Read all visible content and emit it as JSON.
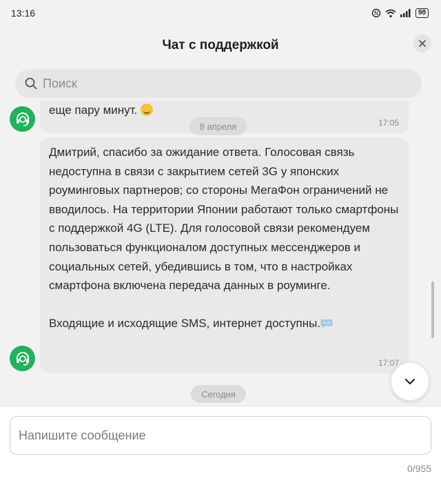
{
  "status_bar": {
    "time": "13:16",
    "battery": "98",
    "icons": [
      "nfc-icon",
      "wifi-icon",
      "signal-icon",
      "battery-icon"
    ]
  },
  "header": {
    "title": "Чат с поддержкой",
    "close_icon": "close-icon"
  },
  "search": {
    "placeholder": "Поиск"
  },
  "chat": {
    "messages": [
      {
        "text": "еще пару минут.",
        "time": "17:05"
      },
      {
        "paragraphs": [
          "Дмитрий, спасибо за ожидание ответа. Голосовая связь недоступна в связи с закрытием сетей 3G у японских роуминговых партнеров; со стороны МегаФон ограничений не вводилось. На территории Японии работают только смартфоны с поддержкой 4G (LTE). Для голосовой связи рекомендуем пользоваться функционалом доступных мессенджеров и социальных сетей, убедившись в том, что в настройках смартфона включена передача данных в роуминге.",
          "Входящие и исходящие SMS, интернет доступны."
        ],
        "time": "17:07"
      }
    ],
    "date_separators": [
      "8 апреля",
      "Сегодня"
    ]
  },
  "composer": {
    "placeholder": "Напишите сообщение",
    "counter": "0/955"
  },
  "colors": {
    "avatar": "#1fb35b",
    "bubble": "#e9e9e9",
    "background": "#f2f2f2"
  }
}
